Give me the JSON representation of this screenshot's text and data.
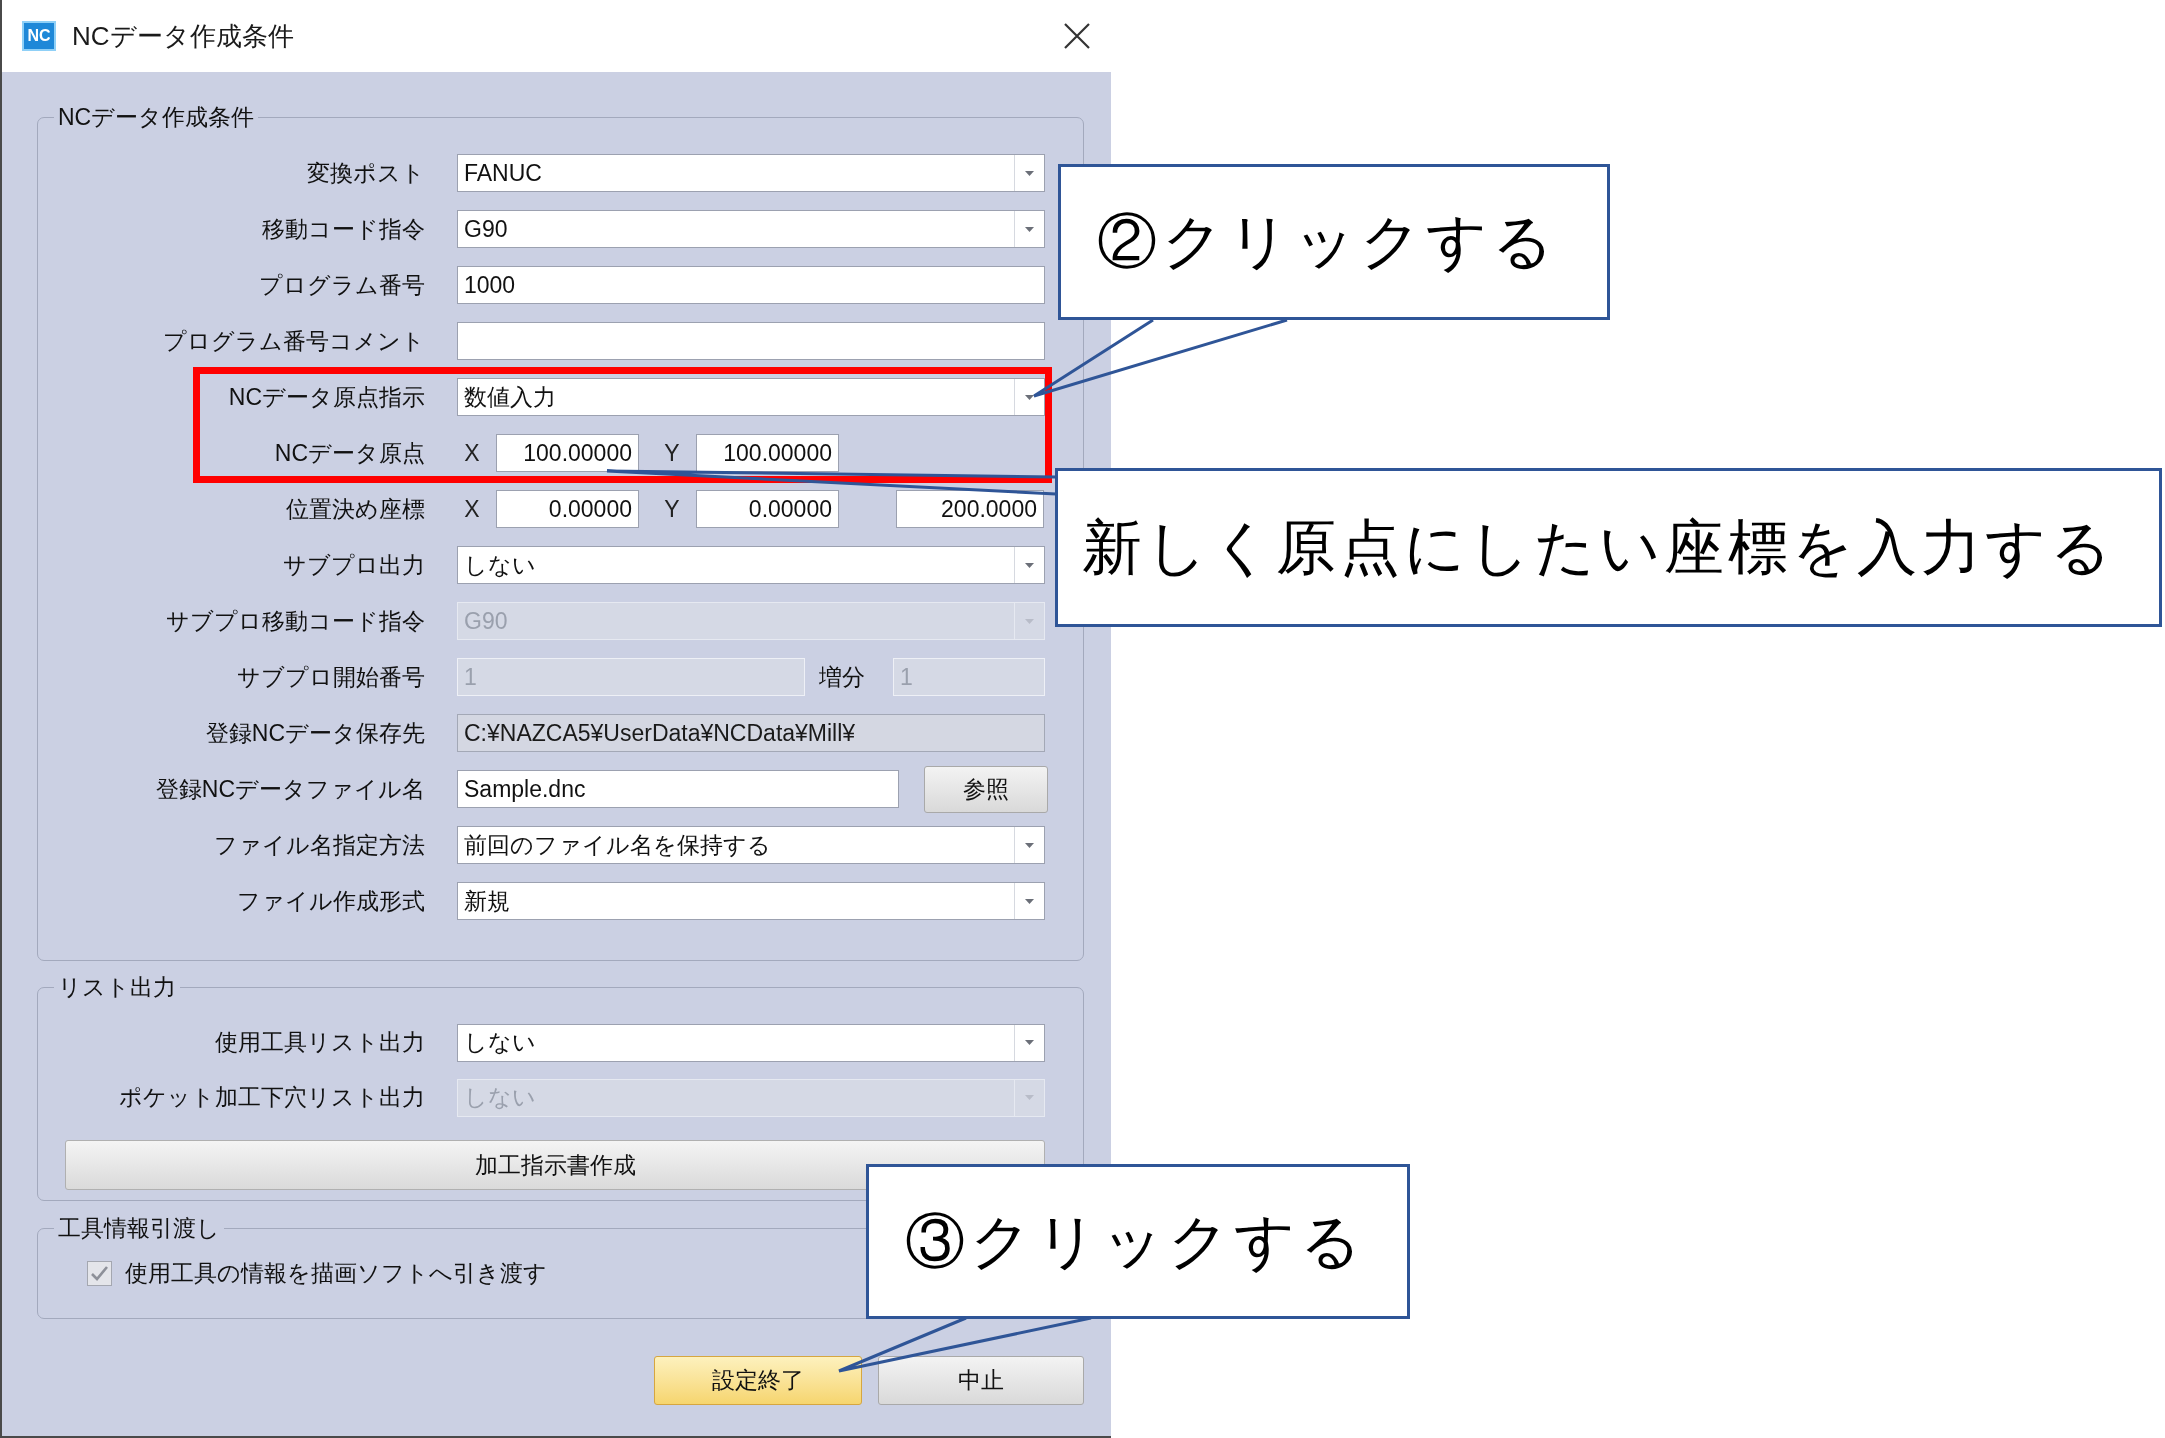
{
  "window": {
    "icon_label": "NC",
    "title": "NCデータ作成条件"
  },
  "groups": [
    {
      "title": "NCデータ作成条件",
      "rows": [
        {
          "kind": "combo",
          "label": "変換ポスト",
          "value": "FANUC",
          "disabled": false,
          "highlighted": false
        },
        {
          "kind": "combo",
          "label": "移動コード指令",
          "value": "G90",
          "disabled": false,
          "highlighted": false
        },
        {
          "kind": "text",
          "label": "プログラム番号",
          "value": "1000",
          "disabled": false,
          "highlighted": false
        },
        {
          "kind": "text",
          "label": "プログラム番号コメント",
          "disabled": false,
          "highlighted": false
        },
        {
          "kind": "combo",
          "label": "NCデータ原点指示",
          "value": "数値入力",
          "disabled": false,
          "highlighted": true
        },
        {
          "kind": "coords",
          "label": "NCデータ原点",
          "fields": [
            {
              "axis": "X",
              "value": "100.00000"
            },
            {
              "axis": "Y",
              "value": "100.00000"
            }
          ],
          "disabled": false,
          "highlighted": true
        },
        {
          "kind": "coords",
          "label": "位置決め座標",
          "fields": [
            {
              "axis": "X",
              "value": "0.00000"
            },
            {
              "axis": "Y",
              "value": "0.00000"
            },
            {
              "value": "200.0000"
            }
          ],
          "disabled": false,
          "highlighted": false
        },
        {
          "kind": "combo",
          "label": "サブプロ出力",
          "value": "しない",
          "disabled": false,
          "highlighted": false
        },
        {
          "kind": "combo",
          "label": "サブプロ移動コード指令",
          "value": "G90",
          "disabled": true,
          "highlighted": false
        },
        {
          "kind": "pair",
          "label": "サブプロ開始番号",
          "value": "1",
          "second_label": "増分",
          "second_value": "1",
          "disabled": true,
          "highlighted": false
        },
        {
          "kind": "readonly",
          "label": "登録NCデータ保存先",
          "value": "C:¥NAZCA5¥UserData¥NCData¥Mill¥",
          "disabled": false,
          "highlighted": false
        },
        {
          "kind": "browse",
          "label": "登録NCデータファイル名",
          "value": "Sample.dnc",
          "button": "参照",
          "disabled": false,
          "highlighted": false
        },
        {
          "kind": "combo",
          "label": "ファイル名指定方法",
          "value": "前回のファイル名を保持する",
          "disabled": false,
          "highlighted": false
        },
        {
          "kind": "combo",
          "label": "ファイル作成形式",
          "value": "新規",
          "disabled": false,
          "highlighted": false
        }
      ]
    },
    {
      "title": "リスト出力",
      "rows": [
        {
          "kind": "combo",
          "label": "使用工具リスト出力",
          "value": "しない",
          "disabled": false,
          "highlighted": false
        },
        {
          "kind": "combo",
          "label": "ポケット加工下穴リスト出力",
          "value": "しない",
          "disabled": true,
          "highlighted": false
        }
      ],
      "button": "加工指示書作成"
    },
    {
      "title": "工具情報引渡し",
      "checkbox": {
        "label": "使用工具の情報を描画ソフトへ引き渡す",
        "checked": true,
        "disabled": true
      }
    }
  ],
  "buttons": [
    {
      "label": "設定終了",
      "default": true
    },
    {
      "label": "中止",
      "default": false
    }
  ],
  "callouts": [
    {
      "text": "②クリックする"
    },
    {
      "text": "新しく原点にしたい座標を入力する"
    },
    {
      "text": "③クリックする"
    }
  ]
}
